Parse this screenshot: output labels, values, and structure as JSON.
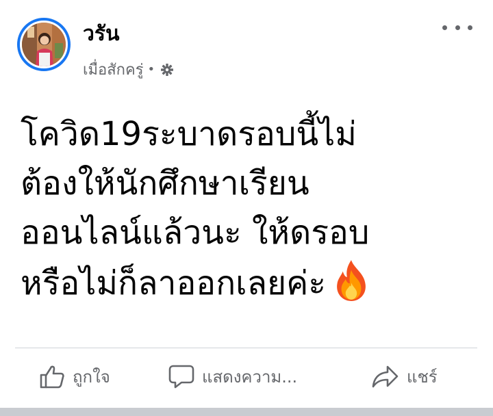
{
  "post": {
    "author": "วรัน",
    "timestamp": "เมื่อสักครู่",
    "separator": "•",
    "privacy_icon": "gear-icon",
    "more_icon": "more-options-icon",
    "text_lines": [
      "โควิด19ระบาดรอบนี้ไม่",
      "ต้องให้นักศึกษาเรียน",
      "ออนไลน์แล้วนะ ให้ดรอบ",
      "หรือไม่ก็ลาออกเลยค่ะ"
    ],
    "emoji": "fire-icon"
  },
  "actions": {
    "like_label": "ถูกใจ",
    "comment_label": "แสดงความ...",
    "share_label": "แชร์"
  },
  "colors": {
    "accent": "#1877f2",
    "secondary_text": "#65676b",
    "divider": "#d0d3d8"
  }
}
